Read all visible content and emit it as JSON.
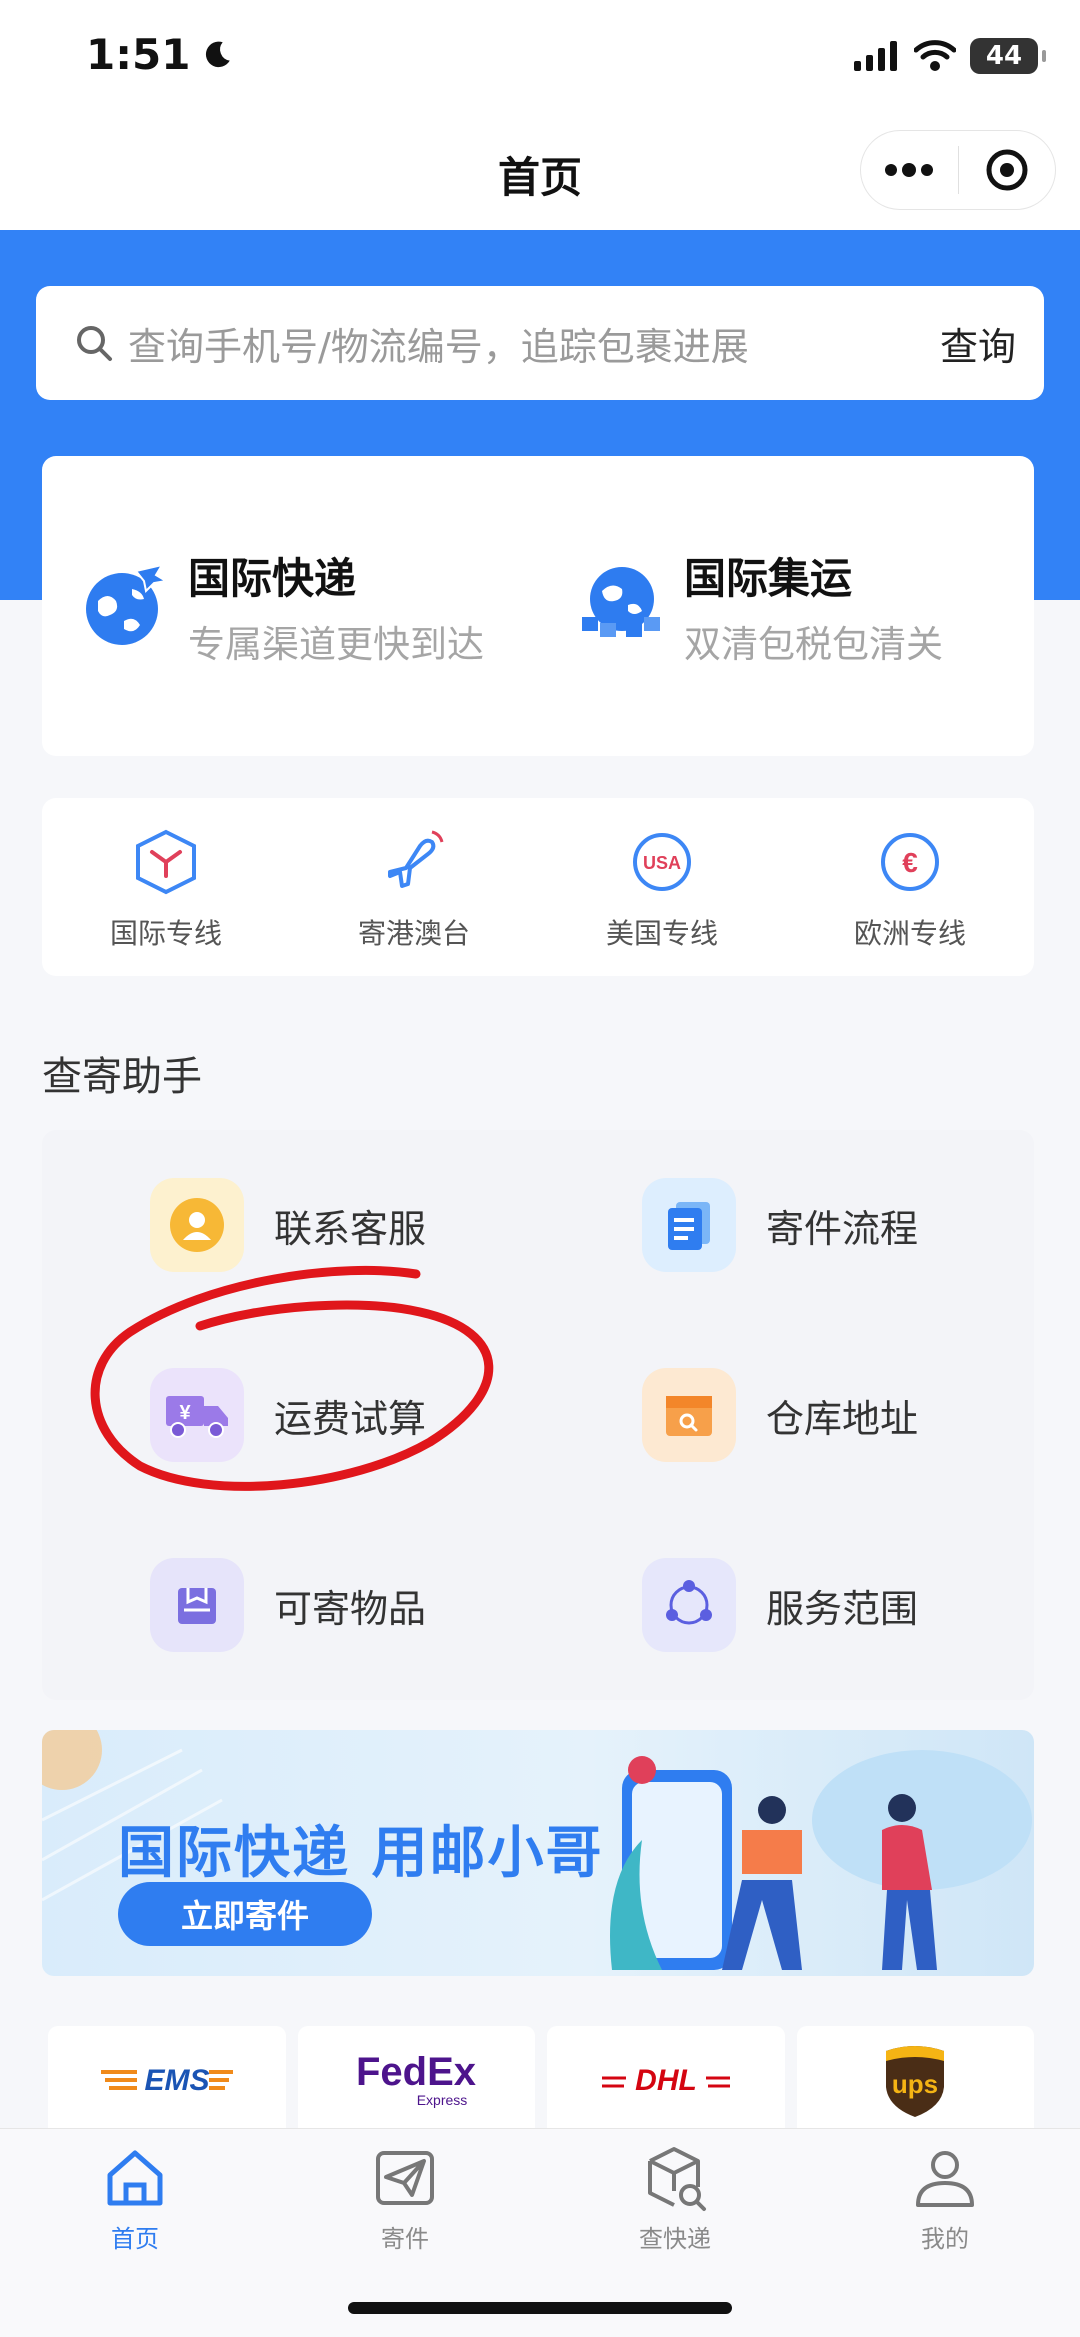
{
  "status_bar": {
    "time": "1:51",
    "battery": "44"
  },
  "navbar": {
    "title": "首页"
  },
  "search": {
    "placeholder": "查询手机号/物流编号，追踪包裹进展",
    "button": "查询"
  },
  "intl_services": [
    {
      "title": "国际快递",
      "subtitle": "专属渠道更快到达",
      "icon": "globe-plane-icon"
    },
    {
      "title": "国际集运",
      "subtitle": "双清包税包清关",
      "icon": "globe-cargo-icon"
    }
  ],
  "lines": [
    {
      "label": "国际专线",
      "icon": "box-icon"
    },
    {
      "label": "寄港澳台",
      "icon": "airplane-icon"
    },
    {
      "label": "美国专线",
      "icon": "usa-icon",
      "badge": "USA"
    },
    {
      "label": "欧洲专线",
      "icon": "euro-icon",
      "badge": "€"
    }
  ],
  "helper": {
    "title": "查寄助手",
    "items": [
      {
        "label": "联系客服",
        "icon": "customer-service-icon"
      },
      {
        "label": "寄件流程",
        "icon": "document-icon"
      },
      {
        "label": "运费试算",
        "icon": "truck-icon",
        "glyph": "¥"
      },
      {
        "label": "仓库地址",
        "icon": "warehouse-box-icon"
      },
      {
        "label": "可寄物品",
        "icon": "package-icon"
      },
      {
        "label": "服务范围",
        "icon": "network-icon"
      }
    ]
  },
  "banner": {
    "text": "国际快递 用邮小哥",
    "button": "立即寄件"
  },
  "carriers": [
    {
      "name": "EMS",
      "color": "#1a54b4"
    },
    {
      "name": "FedEx",
      "sub": "Express"
    },
    {
      "name": "DHL",
      "color": "#d40511"
    },
    {
      "name": "ups"
    }
  ],
  "tabs": [
    {
      "label": "首页",
      "icon": "home-icon",
      "active": true
    },
    {
      "label": "寄件",
      "icon": "send-icon",
      "active": false
    },
    {
      "label": "查快递",
      "icon": "track-icon",
      "active": false
    },
    {
      "label": "我的",
      "icon": "profile-icon",
      "active": false
    }
  ],
  "colors": {
    "primary": "#3282f6",
    "accent": "#2f7df0",
    "annotation": "#e0161b"
  }
}
